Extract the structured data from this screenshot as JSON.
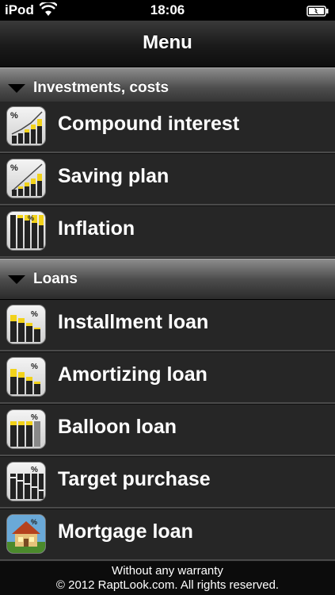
{
  "status": {
    "carrier": "iPod",
    "time": "18:06"
  },
  "nav": {
    "title": "Menu"
  },
  "sections": [
    {
      "label": "Investments, costs",
      "items": [
        {
          "label": "Compound interest",
          "icon": "compound-interest-chart-icon"
        },
        {
          "label": "Saving plan",
          "icon": "saving-plan-chart-icon"
        },
        {
          "label": "Inflation",
          "icon": "inflation-chart-icon"
        }
      ]
    },
    {
      "label": "Loans",
      "items": [
        {
          "label": "Installment loan",
          "icon": "installment-loan-chart-icon"
        },
        {
          "label": "Amortizing loan",
          "icon": "amortizing-loan-chart-icon"
        },
        {
          "label": "Balloon loan",
          "icon": "balloon-loan-chart-icon"
        },
        {
          "label": "Target purchase",
          "icon": "target-purchase-chart-icon"
        },
        {
          "label": "Mortgage loan",
          "icon": "mortgage-loan-house-icon"
        }
      ]
    }
  ],
  "footer": {
    "line1": "Without any warranty",
    "line2": "© 2012 RaptLook.com. All rights reserved."
  },
  "colors": {
    "accent_yellow": "#f2d21a",
    "bar_dark": "#222222",
    "row_bg": "#262626"
  }
}
